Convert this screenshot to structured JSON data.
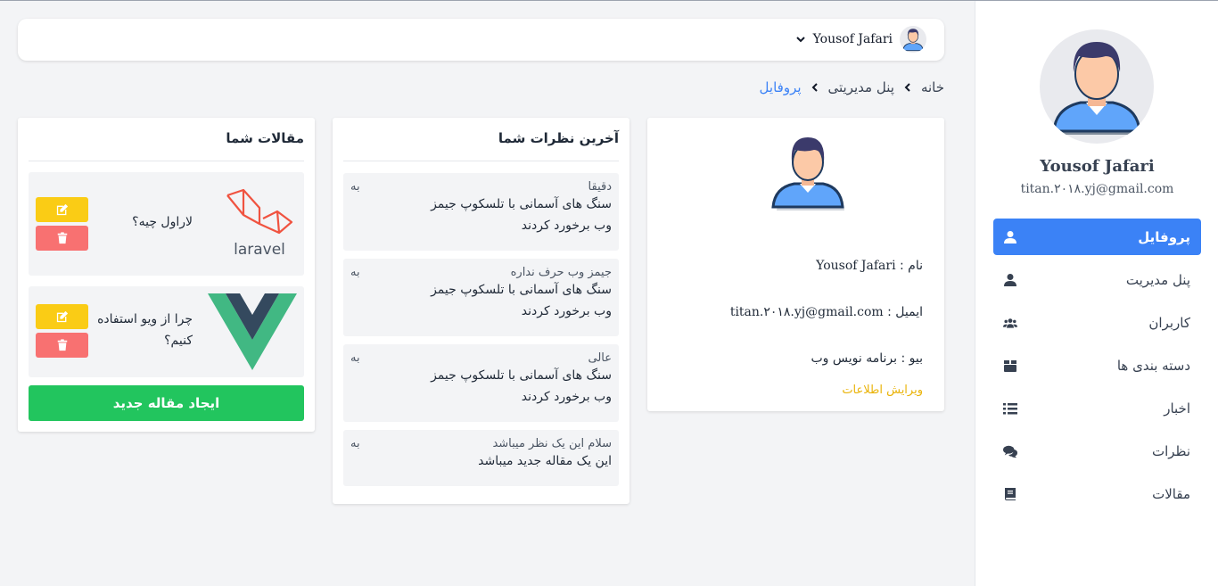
{
  "colors": {
    "accent": "#3b82f6",
    "success": "#22c55e",
    "warning": "#facc15",
    "danger": "#f87171",
    "link": "#eab308"
  },
  "sidebar": {
    "user_name": "Yousof Jafari",
    "user_email": "titan.۲۰۱۸.yj@gmail.com",
    "items": [
      {
        "label": "پروفایل",
        "icon": "user-icon",
        "active": true
      },
      {
        "label": "پنل مدیریت",
        "icon": "user-icon"
      },
      {
        "label": "کاربران",
        "icon": "users-icon"
      },
      {
        "label": "دسته بندی ها",
        "icon": "box-icon"
      },
      {
        "label": "اخبار",
        "icon": "list-icon"
      },
      {
        "label": "نظرات",
        "icon": "comments-icon"
      },
      {
        "label": "مقالات",
        "icon": "book-icon"
      }
    ]
  },
  "topbar": {
    "user_name": "Yousof Jafari"
  },
  "breadcrumb": {
    "home": "خانه",
    "panel": "پنل مدیریتی",
    "current": "پروفایل"
  },
  "profile": {
    "name_label": "نام :",
    "name_value": "Yousof Jafari",
    "email_label": "ایمیل :",
    "email_value": "titan.۲۰۱۸.yj@gmail.com",
    "bio_label": "بیو :",
    "bio_value": "برنامه نویس وب",
    "edit_link": "ویرایش اطلاعات"
  },
  "comments": {
    "title": "آخرین نظرات شما",
    "items": [
      {
        "text": "دقیقا",
        "to": "به",
        "article": "سنگ های آسمانی با تلسکوپ جیمز وب برخورد کردند"
      },
      {
        "text": "جیمز وب حرف نداره",
        "to": "به",
        "article": "سنگ های آسمانی با تلسکوپ جیمز وب برخورد کردند"
      },
      {
        "text": "عالی",
        "to": "به",
        "article": "سنگ های آسمانی با تلسکوپ جیمز وب برخورد کردند"
      },
      {
        "text": "سلام این یک نظر میباشد",
        "to": "به",
        "article": "این یک مقاله جدید میباشد"
      }
    ]
  },
  "articles": {
    "title": "مقالات شما",
    "items": [
      {
        "title": "لاراول چیه؟",
        "logo_text": "laravel"
      },
      {
        "title": "چرا از ویو استفاده کنیم؟"
      }
    ],
    "new_button": "ایجاد مقاله جدید"
  }
}
